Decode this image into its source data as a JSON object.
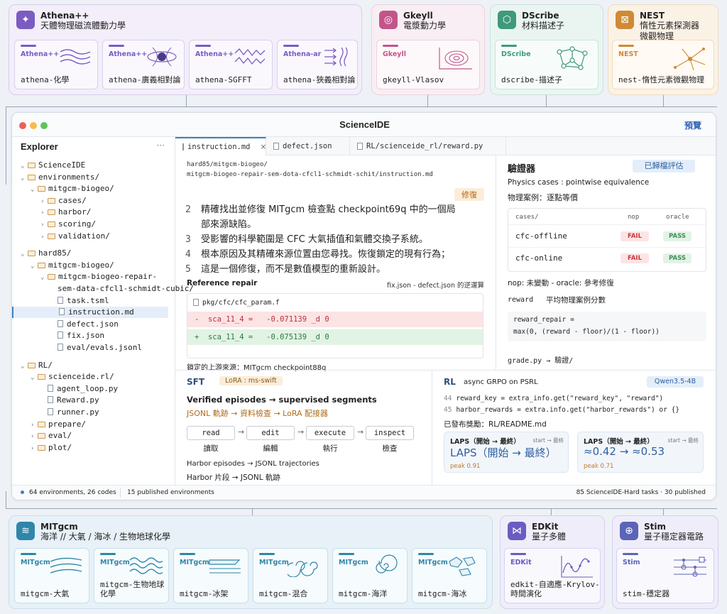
{
  "top_groups": [
    {
      "name": "Athena++",
      "subtitle": "天體物理磁流體動力學",
      "color": "#7a5cc2",
      "cards": [
        {
          "tag": "Athena++",
          "label": "athena-化學"
        },
        {
          "tag": "Athena++",
          "label": "athena-廣義相對論"
        },
        {
          "tag": "Athena++",
          "label": "athena-SGFFT"
        },
        {
          "tag": "Athena-ar",
          "label": "athena-狹義相對論"
        }
      ]
    },
    {
      "name": "Gkeyll",
      "subtitle": "電漿動力學",
      "color": "#c2558a",
      "cards": [
        {
          "tag": "Gkeyll",
          "label": "gkeyll-Vlasov"
        }
      ]
    },
    {
      "name": "DScribe",
      "subtitle": "材料描述子",
      "color": "#3f9a7a",
      "cards": [
        {
          "tag": "DScribe",
          "label": "dscribe-描述子"
        }
      ]
    },
    {
      "name": "NEST",
      "subtitle": "惰性元素探測器\n微觀物理",
      "color": "#d08a34",
      "cards": [
        {
          "tag": "NEST",
          "label": "nest-惰性元素微觀物理"
        }
      ]
    }
  ],
  "window": {
    "title": "ScienceIDE",
    "right_label": "預覽"
  },
  "explorer": {
    "title": "Explorer",
    "more": "···",
    "items": [
      {
        "d": 0,
        "type": "folder",
        "open": true,
        "name": "ScienceIDE"
      },
      {
        "d": 0,
        "type": "folder",
        "open": true,
        "name": "environments/"
      },
      {
        "d": 1,
        "type": "folder",
        "open": true,
        "name": "mitgcm-biogeo/"
      },
      {
        "d": 2,
        "type": "folder",
        "open": false,
        "name": "cases/"
      },
      {
        "d": 2,
        "type": "folder",
        "open": false,
        "name": "harbor/"
      },
      {
        "d": 2,
        "type": "folder",
        "open": false,
        "name": "scoring/"
      },
      {
        "d": 2,
        "type": "folder",
        "open": false,
        "name": "validation/"
      },
      {
        "d": 0,
        "type": "gap"
      },
      {
        "d": 0,
        "type": "folder",
        "open": true,
        "name": "hard85/"
      },
      {
        "d": 1,
        "type": "folder",
        "open": true,
        "name": "mitgcm-biogeo/"
      },
      {
        "d": 2,
        "type": "folder",
        "open": true,
        "name": "mitgcm-biogeo-repair-"
      },
      {
        "d": 3,
        "type": "cont",
        "name": "sem-data-cfcl1-schmidt-cubic/"
      },
      {
        "d": 3,
        "type": "file",
        "name": "task.tsml"
      },
      {
        "d": 3,
        "type": "file",
        "name": "instruction.md",
        "active": true
      },
      {
        "d": 3,
        "type": "file",
        "name": "defect.json"
      },
      {
        "d": 3,
        "type": "file",
        "name": "fix.json"
      },
      {
        "d": 3,
        "type": "file",
        "name": "eval/evals.jsonl"
      },
      {
        "d": 0,
        "type": "gap"
      },
      {
        "d": 0,
        "type": "folder",
        "open": true,
        "name": "RL/"
      },
      {
        "d": 1,
        "type": "folder",
        "open": true,
        "name": "scienceide.rl/"
      },
      {
        "d": 2,
        "type": "file",
        "name": "agent_loop.py"
      },
      {
        "d": 2,
        "type": "file",
        "name": "Reward.py"
      },
      {
        "d": 2,
        "type": "file",
        "name": "runner.py"
      },
      {
        "d": 1,
        "type": "folder",
        "open": false,
        "name": "prepare/"
      },
      {
        "d": 1,
        "type": "folder",
        "open": false,
        "name": "eval/"
      },
      {
        "d": 1,
        "type": "folder",
        "open": false,
        "name": "plot/"
      }
    ]
  },
  "tabs": [
    {
      "label": "instruction.md",
      "close": "×"
    },
    {
      "label": "defect.json"
    },
    {
      "label": "RL/scienceide_rl/reward.py"
    }
  ],
  "editor": {
    "path1": "hard85/mitgcm-biogeo/",
    "path2": "mitgcm-biogeo-repair-sem-dota-cfcl1-schmidt-schit/instruction.md",
    "tag": "修復",
    "lines": [
      {
        "n": "2",
        "text": "精確找出並修復 MITgcm 檢查點 checkpoint69q 中的一個局",
        "cont": "部來源缺陷。"
      },
      {
        "n": "3",
        "text": "受影響的科學範圍是 CFC 大氣插值和氣體交換子系統。"
      },
      {
        "n": "4",
        "text": "根本原因及其精確來源位置由您尋找。恢復鎖定的現有行為；"
      },
      {
        "n": "5",
        "text": "這是一個修復，而不是數值模型的重新設計。"
      }
    ],
    "ref_title": "Reference repair",
    "ref_note": "fix.json - defect.json 的逆運算",
    "diff_file": "pkg/cfc/cfc_param.f",
    "diff_minus": "-  sca_11_4 =   -0.071139 _d 0",
    "diff_plus": "+  sca_11_4 =   -0.075139 _d 0",
    "source": "鎖定的上游來源：MITgcm checkpoint88q"
  },
  "validator": {
    "title": "驗證器",
    "badge": "已歸檔評估",
    "desc1": "Physics cases : pointwise equivalence",
    "desc2": "物理案例：逐點等價",
    "table": {
      "headers": [
        "cases/",
        "nop",
        "oracle"
      ],
      "rows": [
        {
          "case": "cfc-offline",
          "nop": "FAIL",
          "oracle": "PASS"
        },
        {
          "case": "cfc-online",
          "nop": "FAIL",
          "oracle": "PASS"
        }
      ]
    },
    "nop_note": "nop: 未變動 - oracle: 參考修復",
    "reward_label": "reward",
    "reward_desc": "平均物理案例分數",
    "code1": "reward_repair =",
    "code2": "max(0, (reward - floor)/(1 - floor))",
    "grade": "grade.py → 驗證/"
  },
  "sft": {
    "title": "SFT",
    "pill": "LoRA : ms-swift",
    "heading": "Verified episodes → supervised segments",
    "subheading": "JSONL 軌跡 → 資料檢查 → LoRA 配接器",
    "steps": [
      {
        "en": "read",
        "zh": "讀取"
      },
      {
        "en": "edit",
        "zh": "編輯"
      },
      {
        "en": "execute",
        "zh": "執行"
      },
      {
        "en": "inspect",
        "zh": "檢查"
      }
    ],
    "foot1": "Harbor episodes → JSONL trajectories",
    "foot2": "Harbor 片段 → JSONL 軌跡"
  },
  "rl": {
    "title": "RL",
    "desc": "async GRPO on PSRL",
    "pill": "Qwen3.5-4B",
    "code": [
      {
        "n": "44",
        "t": "reward_key = extra_info.get(\"reward_key\", \"reward\")"
      },
      {
        "n": "45",
        "t": "harbor_rewards = extra.info.get(\"harbor_rewards\") or {}"
      }
    ],
    "published": "已發布獎勵：RL/README.md",
    "metrics": [
      {
        "title": "LAPS（開始 → 最終）",
        "small": "start → 最終",
        "value": "LAPS（開始 → 最終）",
        "peak": "peak 0.91"
      },
      {
        "title": "LAPS（開始 → 最終）",
        "small": "start → 最終",
        "value": "≈0.42 → ≈0.53",
        "peak": "peak 0.71"
      }
    ]
  },
  "status": {
    "left": "64 environments, 26 codes",
    "mid": "15 published environments",
    "right": "85 ScienceIDE-Hard tasks · 30 published"
  },
  "bottom_groups": [
    {
      "name": "MITgcm",
      "subtitle": "海洋 // 大氣 / 海冰 / 生物地球化學",
      "color": "#2f86a8",
      "cards": [
        {
          "tag": "MITgcm",
          "label": "mitgcm-大氣"
        },
        {
          "tag": "MITgcm",
          "label": "mitgcm-生物地球\n化學"
        },
        {
          "tag": "MITgcm",
          "label": "mitgcm-冰架"
        },
        {
          "tag": "MITgcm",
          "label": "mitgcm-混合"
        },
        {
          "tag": "MITgcm",
          "label": "mitgcm-海洋"
        },
        {
          "tag": "MITgcm",
          "label": "mitgcm-海冰"
        }
      ]
    },
    {
      "name": "EDKit",
      "subtitle": "量子多體",
      "color": "#6a5cc0",
      "cards": [
        {
          "tag": "EDKit",
          "label": "edkit-自適應-Krylov-\n時間演化"
        }
      ]
    },
    {
      "name": "Stim",
      "subtitle": "量子穩定器電路",
      "color": "#5c64b8",
      "cards": [
        {
          "tag": "Stim",
          "label": "stim-穩定器"
        }
      ]
    }
  ]
}
